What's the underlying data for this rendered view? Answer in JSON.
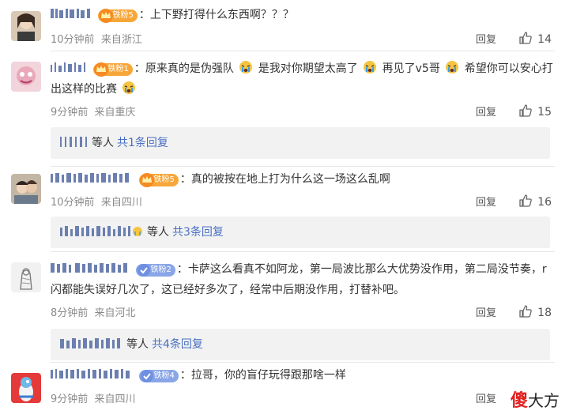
{
  "comments": [
    {
      "badge": "铁粉5",
      "text": "上下野打得什么东西啊？？？",
      "time": "10分钟前",
      "location": "来自浙江",
      "reply_label": "回复",
      "likes": "14"
    },
    {
      "badge": "铁粉1",
      "text_parts": [
        "原来真的是伪强队",
        "是我对你期望太高了",
        "再见了v5哥",
        "希望你可以安心打"
      ],
      "text_line2": "出这样的比赛",
      "time": "9分钟前",
      "location": "来自重庆",
      "reply_label": "回复",
      "likes": "15",
      "sub_reply": {
        "who": "等人",
        "more": "共1条回复"
      }
    },
    {
      "badge": "铁粉5",
      "text": "真的被按在地上打为什么这一场这么乱啊",
      "time": "10分钟前",
      "location": "来自四川",
      "reply_label": "回复",
      "likes": "16",
      "sub_reply": {
        "who": "等人",
        "more": "共3条回复"
      }
    },
    {
      "badge": "铁粉2",
      "text": "卡萨这么看真不如阿龙，第一局波比那么大优势没作用，第二局没节奏，r",
      "text_line2": "闪都能失误好几次了，这已经好多次了，经常中后期没作用，打替补吧。",
      "time": "8分钟前",
      "location": "来自河北",
      "reply_label": "回复",
      "likes": "18",
      "sub_reply": {
        "who": "等人",
        "more": "共4条回复"
      }
    },
    {
      "badge": "铁粉4",
      "text": "拉哥，你的盲仔玩得跟那啥一样",
      "time": "9分钟前",
      "location": "来自四川",
      "reply_label": "回复"
    }
  ],
  "watermark": {
    "first": "傻",
    "rest": "大方"
  },
  "colors": {
    "gold_badge": "#f7a73a",
    "blue_badge": "#8aa6e8",
    "link": "#4a70c2"
  }
}
